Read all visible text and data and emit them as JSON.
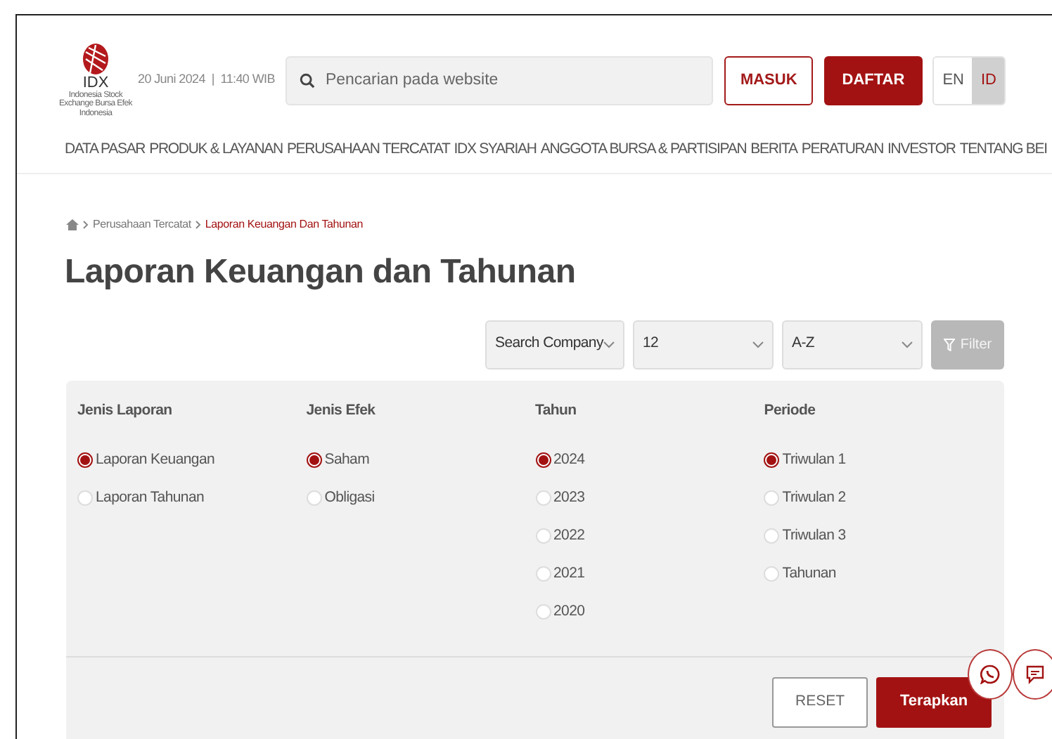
{
  "header": {
    "logo_text": "IDX",
    "logo_subtitle": "Indonesia Stock Exchange Bursa Efek Indonesia",
    "datetime": "20 Juni 2024  |  11:40 WIB",
    "search": {
      "placeholder": "Pencarian pada website"
    },
    "login_button": "MASUK",
    "register_button": "DAFTAR",
    "languages": [
      {
        "label": "EN",
        "selected": false
      },
      {
        "label": "ID",
        "selected": true
      }
    ]
  },
  "nav": [
    "DATA PASAR",
    "PRODUK & LAYANAN",
    "PERUSAHAAN TERCATAT",
    "IDX SYARIAH",
    "ANGGOTA BURSA & PARTISIPAN",
    "BERITA",
    "PERATURAN",
    "INVESTOR",
    "TENTANG BEI"
  ],
  "breadcrumb": [
    {
      "label": "Perusahaan Tercatat",
      "selected": false
    },
    {
      "label": "Laporan Keuangan Dan Tahunan",
      "selected": true
    }
  ],
  "title": "Laporan Keuangan dan Tahunan",
  "selects": [
    "Search Company",
    "12",
    "A-Z"
  ],
  "filter_button": {
    "label": "Filter",
    "disabled": true
  },
  "filter_groups": [
    {
      "heading": "Jenis Laporan",
      "options": [
        {
          "label": "Laporan Keuangan",
          "selected": true
        },
        {
          "label": "Laporan Tahunan",
          "selected": false
        }
      ]
    },
    {
      "heading": "Jenis Efek",
      "options": [
        {
          "label": "Saham",
          "selected": true
        },
        {
          "label": "Obligasi",
          "selected": false
        }
      ]
    },
    {
      "heading": "Tahun",
      "options": [
        {
          "label": "2024",
          "selected": true
        },
        {
          "label": "2023",
          "selected": false
        },
        {
          "label": "2022",
          "selected": false
        },
        {
          "label": "2021",
          "selected": false
        },
        {
          "label": "2020",
          "selected": false
        }
      ]
    },
    {
      "heading": "Periode",
      "options": [
        {
          "label": "Triwulan 1",
          "selected": true
        },
        {
          "label": "Triwulan 2",
          "selected": false
        },
        {
          "label": "Triwulan 3",
          "selected": false
        },
        {
          "label": "Tahunan",
          "selected": false
        }
      ]
    }
  ],
  "reset_button": "RESET",
  "apply_button": "Terapkan"
}
